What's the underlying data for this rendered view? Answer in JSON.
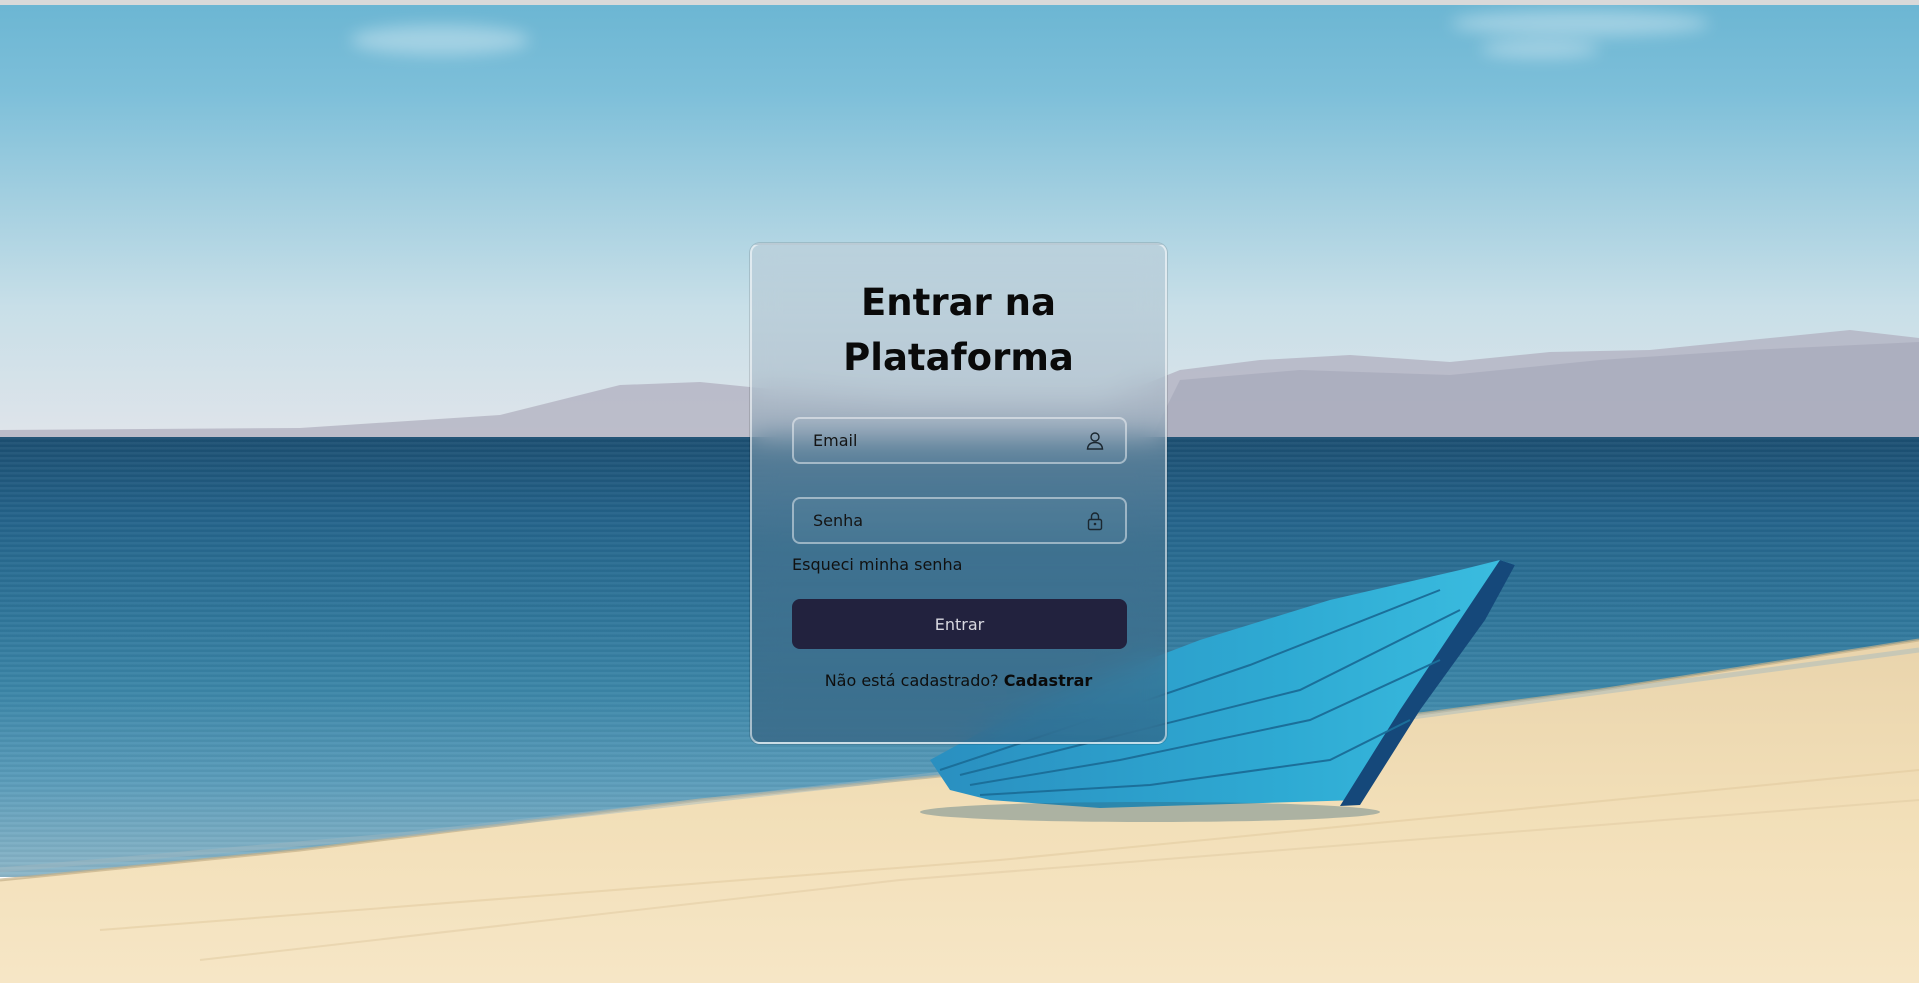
{
  "login": {
    "title_line1": "Entrar na",
    "title_line2": "Plataforma",
    "email": {
      "placeholder": "Email",
      "value": "",
      "icon": "user-icon"
    },
    "password": {
      "placeholder": "Senha",
      "value": "",
      "icon": "lock-icon"
    },
    "forgot_password": "Esqueci minha senha",
    "submit_label": "Entrar",
    "register_prompt": "Não está cadastrado?",
    "register_link": "Cadastrar"
  },
  "colors": {
    "button_background": "#22223e",
    "title_text": "#0a0a0a",
    "boat": "#2aa7d0"
  },
  "background": {
    "scene": "beach with blue boat on sand"
  }
}
